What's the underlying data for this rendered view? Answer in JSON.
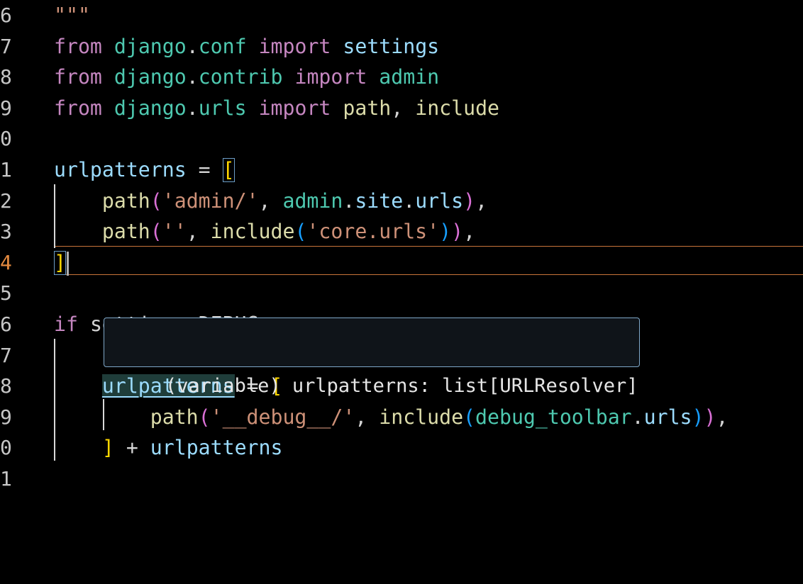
{
  "editor": {
    "language": "python",
    "active_line": "4",
    "lines": [
      {
        "num": "6",
        "tokens": [
          {
            "t": "\"\"\"",
            "c": "doc"
          }
        ]
      },
      {
        "num": "7",
        "tokens": [
          {
            "t": "from",
            "c": "kw"
          },
          {
            "t": " ",
            "c": "p"
          },
          {
            "t": "django",
            "c": "mod"
          },
          {
            "t": ".",
            "c": "p"
          },
          {
            "t": "conf",
            "c": "mod"
          },
          {
            "t": " ",
            "c": "p"
          },
          {
            "t": "import",
            "c": "kw"
          },
          {
            "t": " ",
            "c": "p"
          },
          {
            "t": "settings",
            "c": "var"
          }
        ]
      },
      {
        "num": "8",
        "tokens": [
          {
            "t": "from",
            "c": "kw"
          },
          {
            "t": " ",
            "c": "p"
          },
          {
            "t": "django",
            "c": "mod"
          },
          {
            "t": ".",
            "c": "p"
          },
          {
            "t": "contrib",
            "c": "mod"
          },
          {
            "t": " ",
            "c": "p"
          },
          {
            "t": "import",
            "c": "kw"
          },
          {
            "t": " ",
            "c": "p"
          },
          {
            "t": "admin",
            "c": "mod"
          }
        ]
      },
      {
        "num": "9",
        "tokens": [
          {
            "t": "from",
            "c": "kw"
          },
          {
            "t": " ",
            "c": "p"
          },
          {
            "t": "django",
            "c": "mod"
          },
          {
            "t": ".",
            "c": "p"
          },
          {
            "t": "urls",
            "c": "mod"
          },
          {
            "t": " ",
            "c": "p"
          },
          {
            "t": "import",
            "c": "kw"
          },
          {
            "t": " ",
            "c": "p"
          },
          {
            "t": "path",
            "c": "fn"
          },
          {
            "t": ", ",
            "c": "p"
          },
          {
            "t": "include",
            "c": "fn"
          }
        ]
      },
      {
        "num": "0",
        "tokens": []
      },
      {
        "num": "1",
        "tokens": [
          {
            "t": "urlpatterns",
            "c": "var"
          },
          {
            "t": " = ",
            "c": "op"
          },
          {
            "t": "[",
            "c": "br1",
            "box": true
          }
        ]
      },
      {
        "num": "2",
        "tokens": [
          {
            "t": "    ",
            "c": "p"
          },
          {
            "t": "path",
            "c": "fn"
          },
          {
            "t": "(",
            "c": "br2"
          },
          {
            "t": "'admin/'",
            "c": "str"
          },
          {
            "t": ", ",
            "c": "p"
          },
          {
            "t": "admin",
            "c": "mod"
          },
          {
            "t": ".",
            "c": "p"
          },
          {
            "t": "site",
            "c": "var"
          },
          {
            "t": ".",
            "c": "p"
          },
          {
            "t": "urls",
            "c": "var"
          },
          {
            "t": ")",
            "c": "br2"
          },
          {
            "t": ",",
            "c": "p"
          }
        ]
      },
      {
        "num": "3",
        "tokens": [
          {
            "t": "    ",
            "c": "p"
          },
          {
            "t": "path",
            "c": "fn"
          },
          {
            "t": "(",
            "c": "br2"
          },
          {
            "t": "''",
            "c": "str"
          },
          {
            "t": ", ",
            "c": "p"
          },
          {
            "t": "include",
            "c": "fn"
          },
          {
            "t": "(",
            "c": "br3"
          },
          {
            "t": "'core.urls'",
            "c": "str"
          },
          {
            "t": ")",
            "c": "br3"
          },
          {
            "t": ")",
            "c": "br2"
          },
          {
            "t": ",",
            "c": "p"
          }
        ]
      },
      {
        "num": "4",
        "tokens": [
          {
            "t": "]",
            "c": "br1",
            "box": true,
            "cursor": true
          }
        ]
      },
      {
        "num": "5",
        "tokens": []
      },
      {
        "num": "6",
        "tokens": [
          {
            "t": "if",
            "c": "kw"
          },
          {
            "t": " ",
            "c": "p"
          },
          {
            "t": "settings.DEBUG:",
            "c": "ghost"
          }
        ]
      },
      {
        "num": "7",
        "tokens": []
      },
      {
        "num": "8",
        "tokens": [
          {
            "t": "    ",
            "c": "p"
          },
          {
            "t": "urlpatterns",
            "c": "var",
            "link": true
          },
          {
            "t": " = ",
            "c": "op"
          },
          {
            "t": "[",
            "c": "br1"
          }
        ]
      },
      {
        "num": "9",
        "tokens": [
          {
            "t": "        ",
            "c": "p"
          },
          {
            "t": "path",
            "c": "fn"
          },
          {
            "t": "(",
            "c": "br2"
          },
          {
            "t": "'__debug__/'",
            "c": "str"
          },
          {
            "t": ", ",
            "c": "p"
          },
          {
            "t": "include",
            "c": "fn"
          },
          {
            "t": "(",
            "c": "br3"
          },
          {
            "t": "debug_toolbar",
            "c": "mod"
          },
          {
            "t": ".",
            "c": "p"
          },
          {
            "t": "urls",
            "c": "var"
          },
          {
            "t": ")",
            "c": "br3"
          },
          {
            "t": ")",
            "c": "br2"
          },
          {
            "t": ",",
            "c": "p"
          }
        ]
      },
      {
        "num": "0",
        "tokens": [
          {
            "t": "    ",
            "c": "p"
          },
          {
            "t": "]",
            "c": "br1"
          },
          {
            "t": " + ",
            "c": "op"
          },
          {
            "t": "urlpatterns",
            "c": "var"
          }
        ]
      },
      {
        "num": "1",
        "tokens": []
      }
    ]
  },
  "hover": {
    "text": "(variable) urlpatterns: list[URLResolver]"
  },
  "colors": {
    "background": "#000000",
    "keyword": "#c586c0",
    "module": "#4ec9b0",
    "variable": "#9cdcfe",
    "function": "#dcdcaa",
    "string": "#ce9178",
    "bracket_level_1": "#ffd700",
    "bracket_level_2": "#da70d6",
    "bracket_level_3": "#179fff",
    "current_line_border": "#c8743a",
    "hover_border": "#7fa8c9"
  }
}
